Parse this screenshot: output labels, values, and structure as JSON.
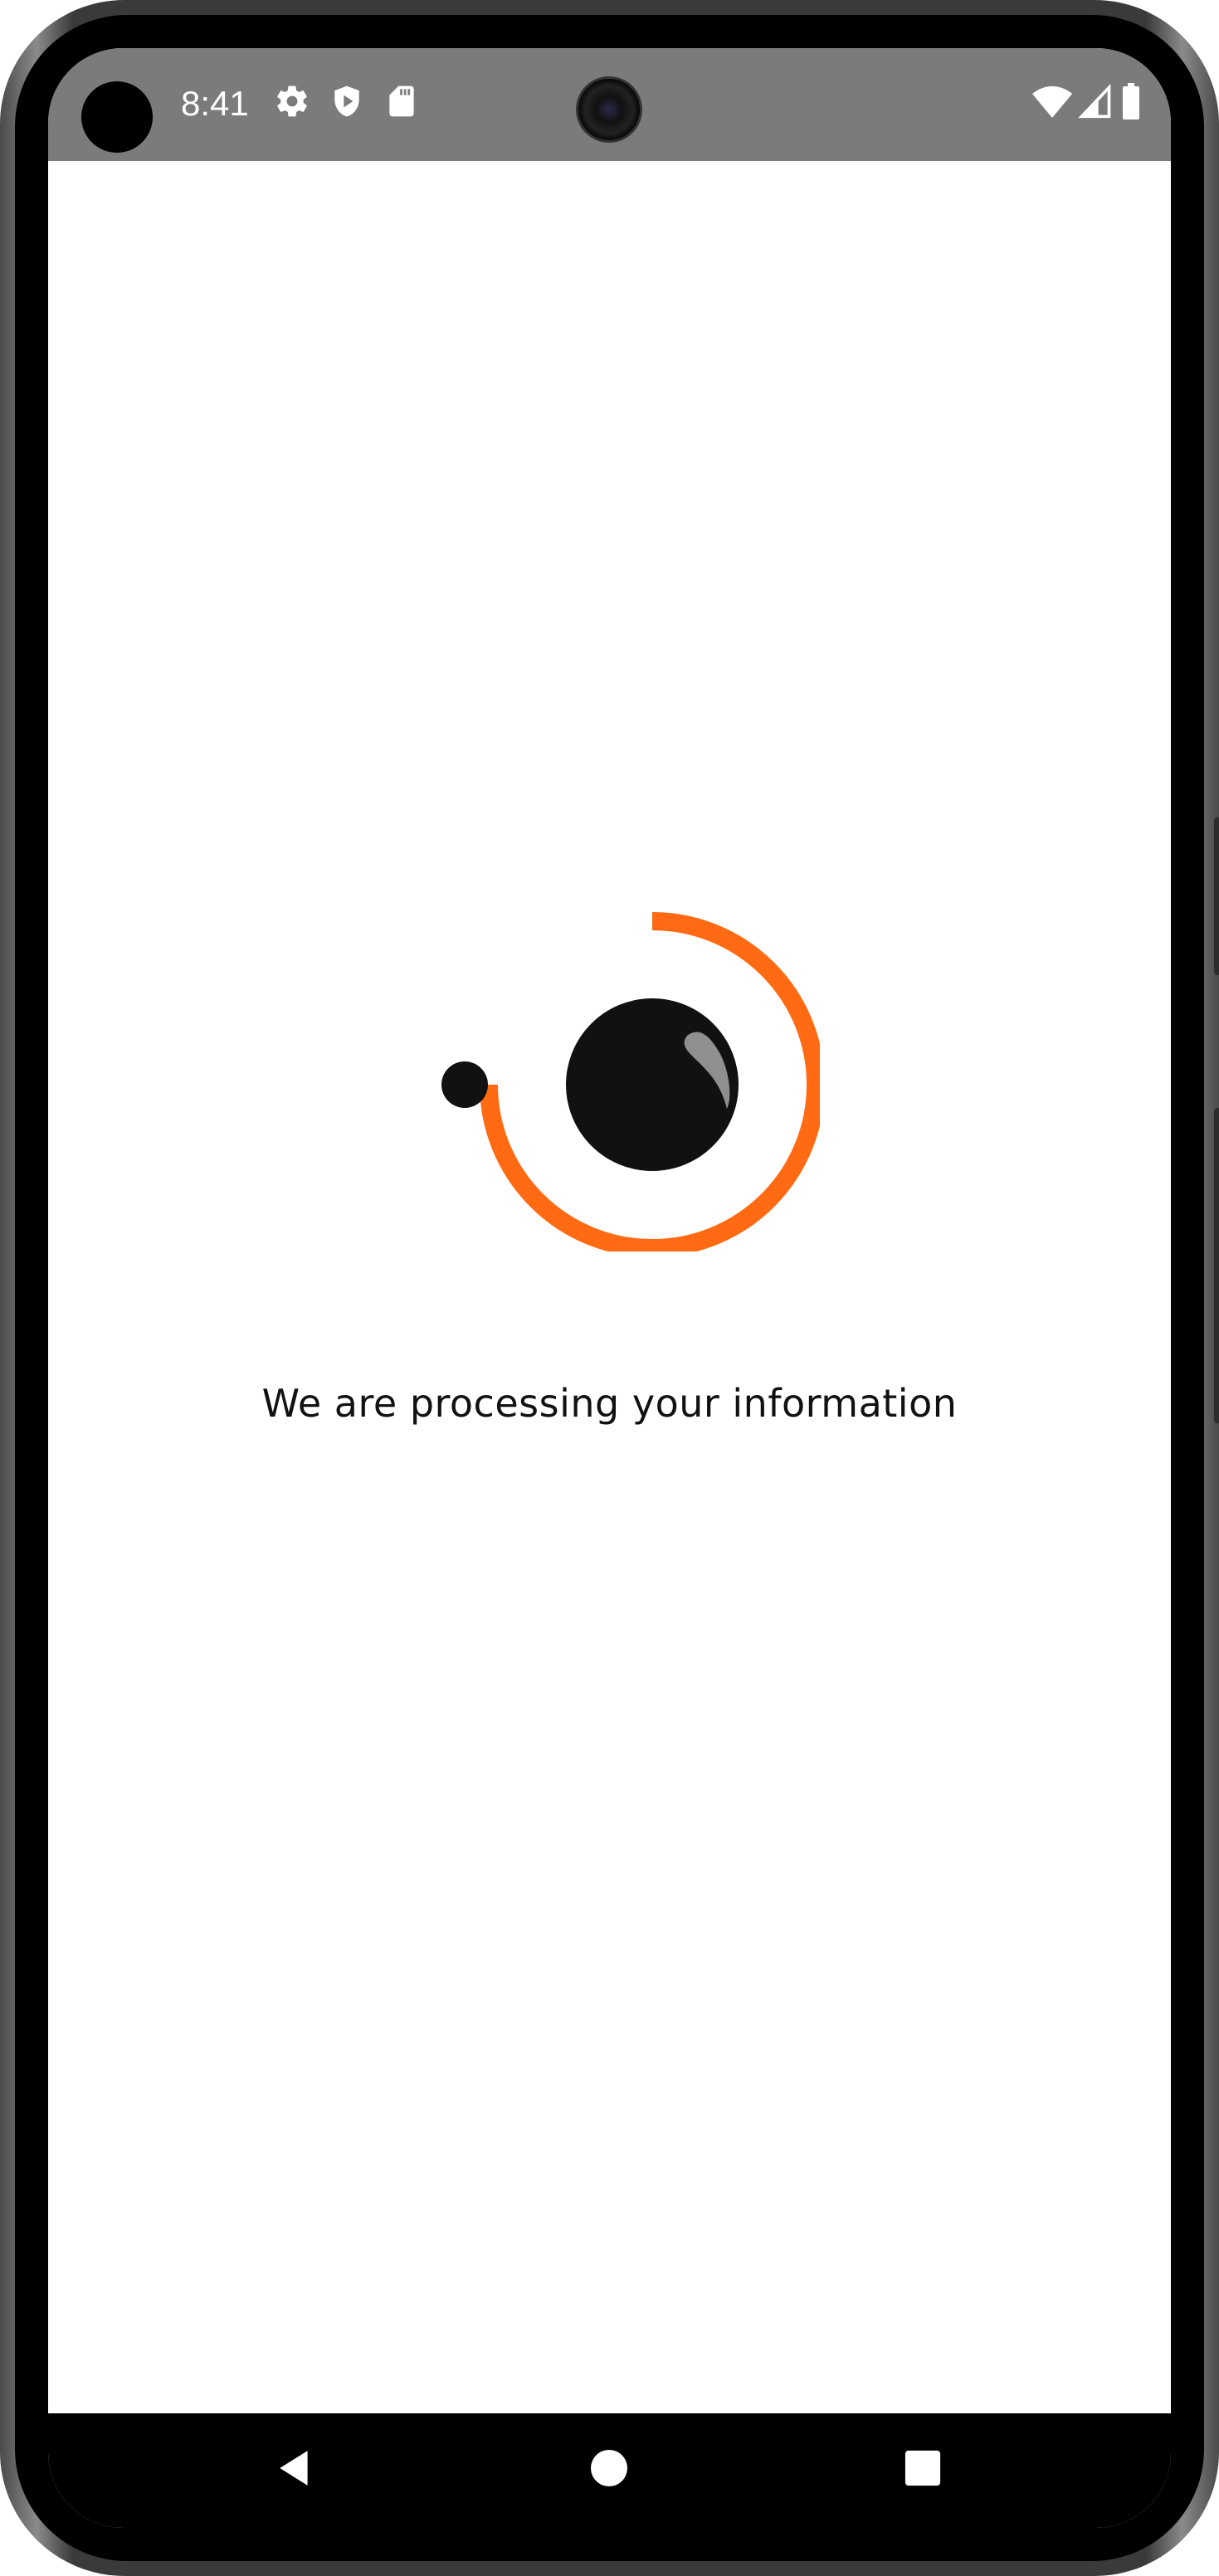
{
  "status_bar": {
    "time": "8:41",
    "icons": [
      "gear-icon",
      "shield-play-icon",
      "sd-card-icon",
      "wifi-icon",
      "signal-icon",
      "battery-icon"
    ],
    "background": "#7b7b7b"
  },
  "loader": {
    "accent_color": "#ff6a13",
    "center_color": "#111111"
  },
  "main": {
    "message": "We are processing your information"
  },
  "nav_bar": {
    "buttons": [
      "back-icon",
      "home-icon",
      "recents-icon"
    ]
  }
}
